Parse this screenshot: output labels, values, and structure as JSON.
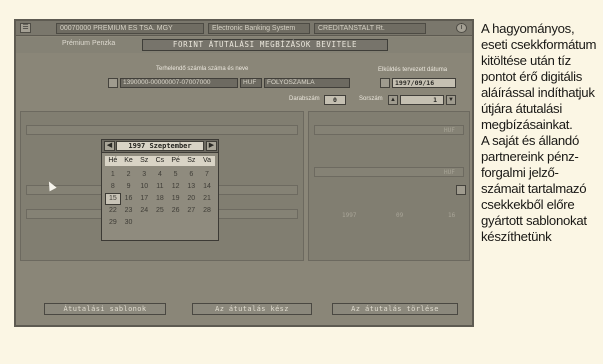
{
  "window": {
    "menu_label": "☰",
    "account_info": "00070000 PREMIUM ES TSA. MGY",
    "system_name": "Electronic Banking System",
    "bank_name": "CREDITANSTALT Rt.",
    "info_label": "i",
    "sub_label": "Prémium Penzka",
    "banner": "FORINT ÁTUTALÁSI MEGBÍZÁSOK BEVITELE"
  },
  "form": {
    "debit_account_label": "Terhelendő számla száma és neve",
    "debit_account_number": "1390000-00000007-07007000",
    "currency": "HUF",
    "account_type": "FOLYÓSZÁMLA",
    "date_label": "Elküldés tervezett dátuma",
    "date_value": "1997/09/16",
    "count_label": "Darabszám",
    "count_value": "0",
    "serial_label": "Sorszám",
    "serial_value": "1",
    "currency_right_1": "HUF",
    "currency_right_2": "HUF",
    "footer_year": "1997",
    "footer_a": "09",
    "footer_b": "16"
  },
  "calendar": {
    "month_label": "1997 Szeptember",
    "prev_label": "◀",
    "next_label": "▶",
    "weekdays": [
      "Hé",
      "Ke",
      "Sz",
      "Cs",
      "Pé",
      "Sz",
      "Va"
    ],
    "rows": [
      [
        "1",
        "2",
        "3",
        "4",
        "5",
        "6",
        "7"
      ],
      [
        "8",
        "9",
        "10",
        "11",
        "12",
        "13",
        "14"
      ],
      [
        "15",
        "16",
        "17",
        "18",
        "19",
        "20",
        "21"
      ],
      [
        "22",
        "23",
        "24",
        "25",
        "26",
        "27",
        "28"
      ],
      [
        "29",
        "30",
        "",
        "",
        "",
        "",
        ""
      ]
    ],
    "selected_day": "15"
  },
  "buttons": {
    "templates": "Átutalási sablonok",
    "done": "Az átutalás kész",
    "delete": "Az átutalás törlése"
  },
  "caption": {
    "lines": [
      "A hagyományos,",
      "eseti csekkformátum",
      "kitöltése után tíz",
      "pontot érő digitális",
      "aláírással indíthatjuk",
      "útjára átutalási",
      "megbízásainkat.",
      "A saját és állandó",
      "partnereink pénz-",
      "forgalmi jelző-",
      "számait tartalmazó",
      "csekkekből előre",
      "gyártott sablonokat",
      "készíthetünk"
    ]
  }
}
